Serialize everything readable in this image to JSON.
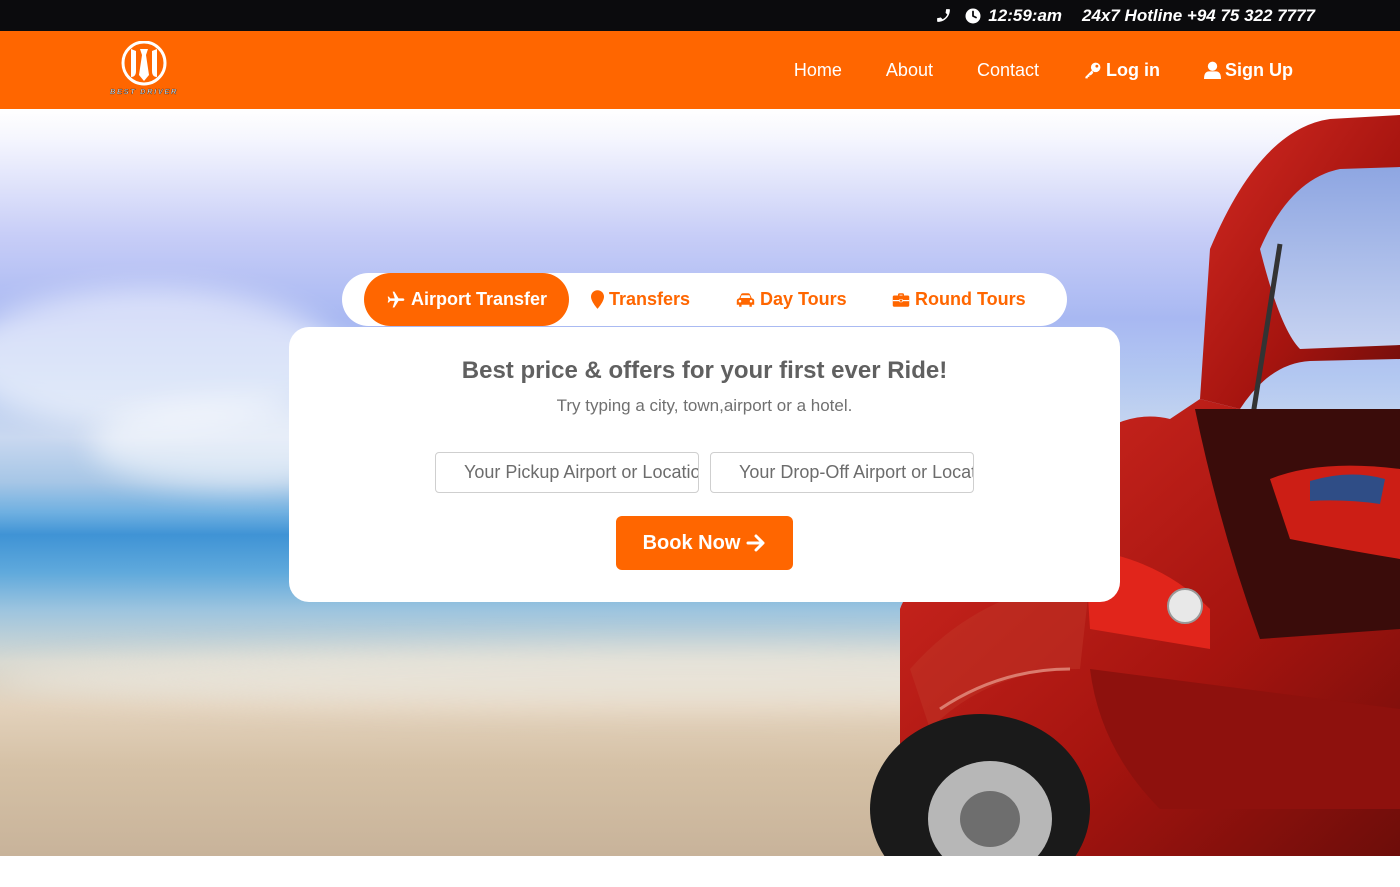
{
  "topbar": {
    "time": "12:59:am",
    "hotline": "24x7 Hotline +94 75 322 7777",
    "icons": [
      "phone-icon",
      "clock-icon"
    ]
  },
  "brand": {
    "logo_text": "BEST DRIVER",
    "color": "#ff6600"
  },
  "nav": {
    "home": "Home",
    "about": "About",
    "contact": "Contact",
    "login": "Log in",
    "signup": "Sign Up"
  },
  "tabs": {
    "airport": "Airport Transfer",
    "transfers": "Transfers",
    "day_tours": "Day Tours",
    "round_tours": "Round Tours",
    "active": "Airport Transfer"
  },
  "booking": {
    "headline": "Best price & offers for your first ever Ride!",
    "subtitle": "Try typing a city, town,airport or a hotel.",
    "pickup_placeholder": "Your Pickup Airport or Location",
    "dropoff_placeholder": "Your Drop-Off Airport or Location",
    "button": "Book Now"
  },
  "colors": {
    "accent": "#ff6600",
    "topbar": "#0b0b0d",
    "text_muted": "#606060"
  }
}
